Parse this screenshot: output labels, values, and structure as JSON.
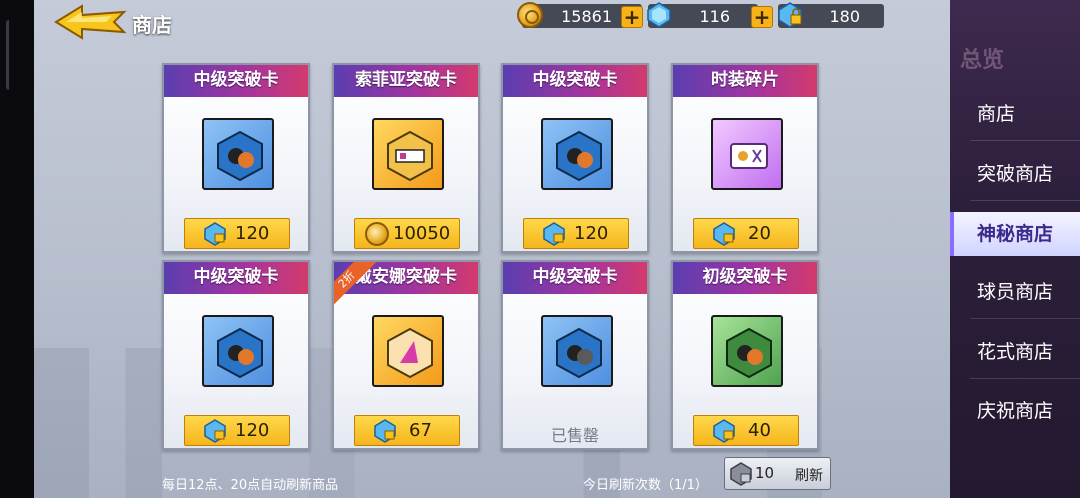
{
  "header": {
    "title": "商店",
    "currencies": {
      "coins": "15861",
      "gems": "116",
      "locked_gems": "180"
    }
  },
  "sidebar": {
    "title": "总览",
    "items": [
      {
        "label": "商店",
        "active": false
      },
      {
        "label": "突破商店",
        "active": false
      },
      {
        "label": "神秘商店",
        "active": true
      },
      {
        "label": "球员商店",
        "active": false
      },
      {
        "label": "花式商店",
        "active": false
      },
      {
        "label": "庆祝商店",
        "active": false
      }
    ]
  },
  "shop": {
    "items": [
      {
        "name": "中级突破卡",
        "price": "120",
        "currency": "gem",
        "color": "blue",
        "sold": false
      },
      {
        "name": "索菲亚突破卡",
        "price": "10050",
        "currency": "coin",
        "color": "orange",
        "sold": false
      },
      {
        "name": "中级突破卡",
        "price": "120",
        "currency": "gem",
        "color": "blue",
        "sold": false
      },
      {
        "name": "时装碎片",
        "price": "20",
        "currency": "gem",
        "color": "purple",
        "sold": false
      },
      {
        "name": "中级突破卡",
        "price": "120",
        "currency": "gem",
        "color": "blue",
        "sold": false
      },
      {
        "name": "戴安娜突破卡",
        "price": "67",
        "currency": "gem",
        "color": "orange",
        "sold": false,
        "discount": "2折"
      },
      {
        "name": "中级突破卡",
        "price": "",
        "currency": "gem",
        "color": "blue",
        "sold": true,
        "sold_label": "已售罄"
      },
      {
        "name": "初级突破卡",
        "price": "40",
        "currency": "gem",
        "color": "green",
        "sold": false
      }
    ]
  },
  "footer": {
    "auto_refresh_note": "每日12点、20点自动刷新商品",
    "refresh_count_text": "今日刷新次数（1/1）",
    "refresh_cost": "10",
    "refresh_label": "刷新"
  }
}
